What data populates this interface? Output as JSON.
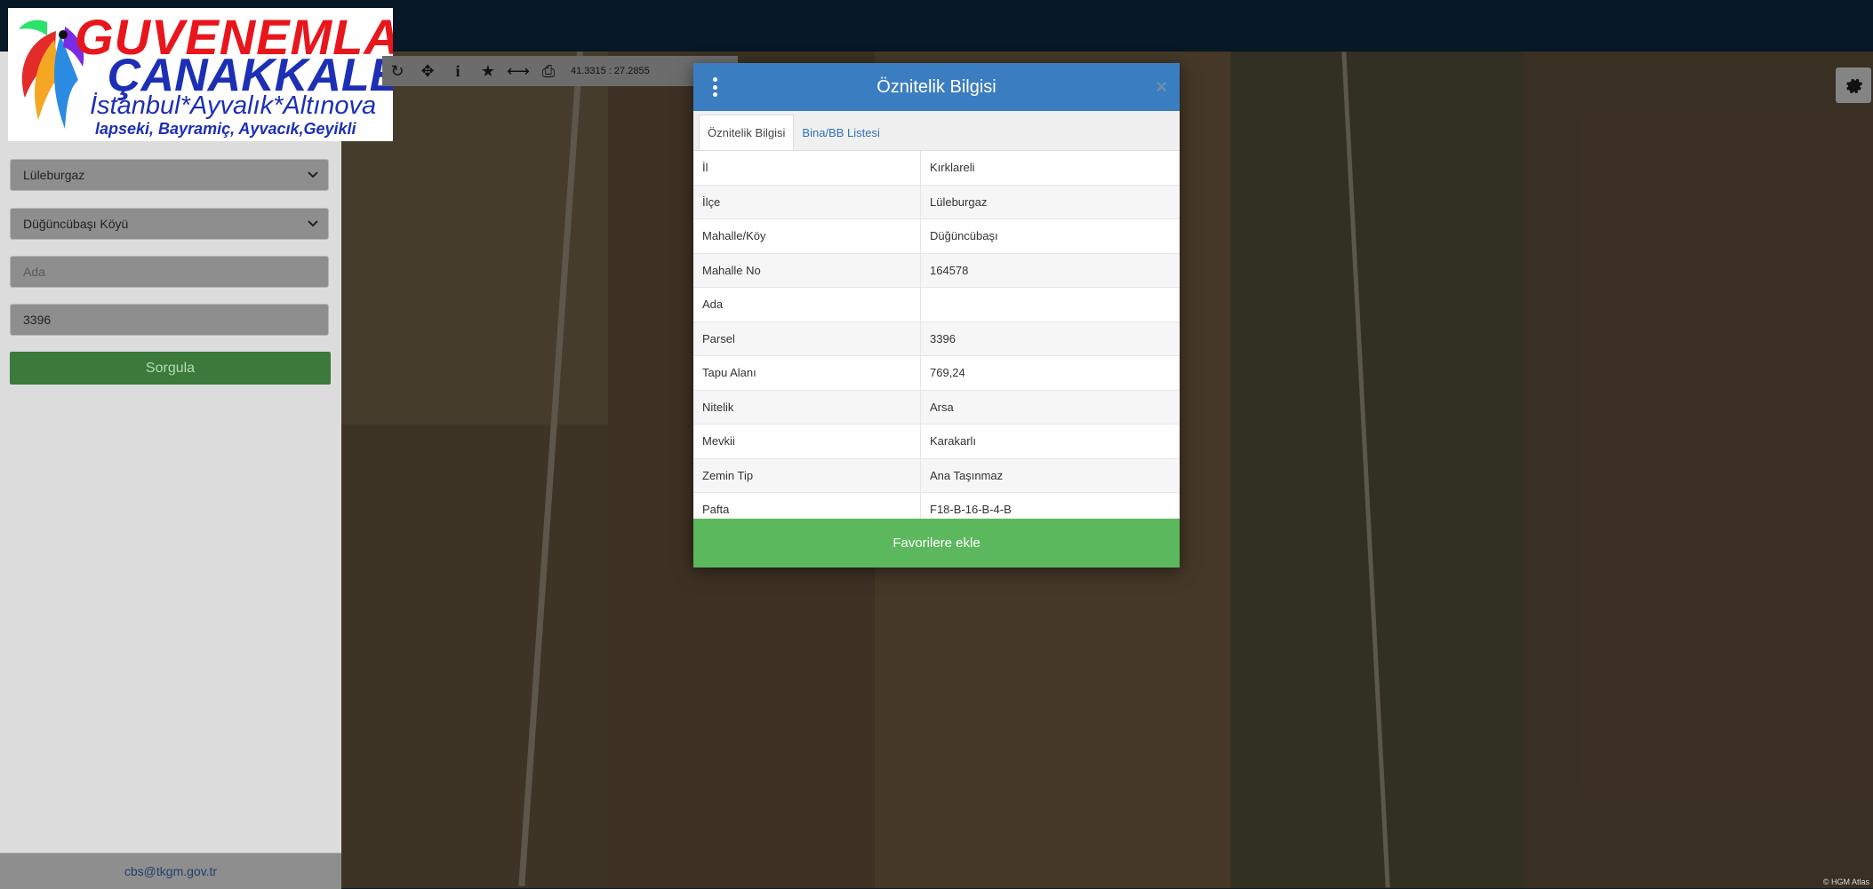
{
  "sidebar": {
    "il_select": "Lüleburgaz",
    "mahalle_select": "Düğüncübaşı Köyü",
    "ada_placeholder": "Ada",
    "parsel_value": "3396",
    "query_button": "Sorgula",
    "footer_email": "cbs@tkgm.gov.tr"
  },
  "logo": {
    "line1": "GUVENEMLAK",
    "line2": "ÇANAKKALE",
    "line3": "İstanbul*Ayvalık*Altınova",
    "line4": "lapseki, Bayramiç, Ayvacık,Geyikli"
  },
  "toolbar": {
    "coords": "41.3315 : 27.2855"
  },
  "modal": {
    "title": "Öznitelik Bilgisi",
    "close": "×",
    "tabs": [
      "Öznitelik Bilgisi",
      "Bina/BB Listesi"
    ],
    "rows": [
      {
        "k": "İl",
        "v": "Kırklareli"
      },
      {
        "k": "İlçe",
        "v": "Lüleburgaz"
      },
      {
        "k": "Mahalle/Köy",
        "v": "Düğüncübaşı"
      },
      {
        "k": "Mahalle No",
        "v": "164578"
      },
      {
        "k": "Ada",
        "v": ""
      },
      {
        "k": "Parsel",
        "v": "3396"
      },
      {
        "k": "Tapu Alanı",
        "v": "769,24"
      },
      {
        "k": "Nitelik",
        "v": "Arsa"
      },
      {
        "k": "Mevkii",
        "v": "Karakarlı"
      },
      {
        "k": "Zemin Tip",
        "v": "Ana Taşınmaz"
      },
      {
        "k": "Pafta",
        "v": "F18-B-16-B-4-B"
      }
    ],
    "favorite_button": "Favorilere ekle"
  },
  "map": {
    "attribution": "© HGM Atlas"
  },
  "colors": {
    "header_blue": "#3b7dc1",
    "favorite_green": "#5cb85c",
    "query_green": "#3c7a3c"
  }
}
